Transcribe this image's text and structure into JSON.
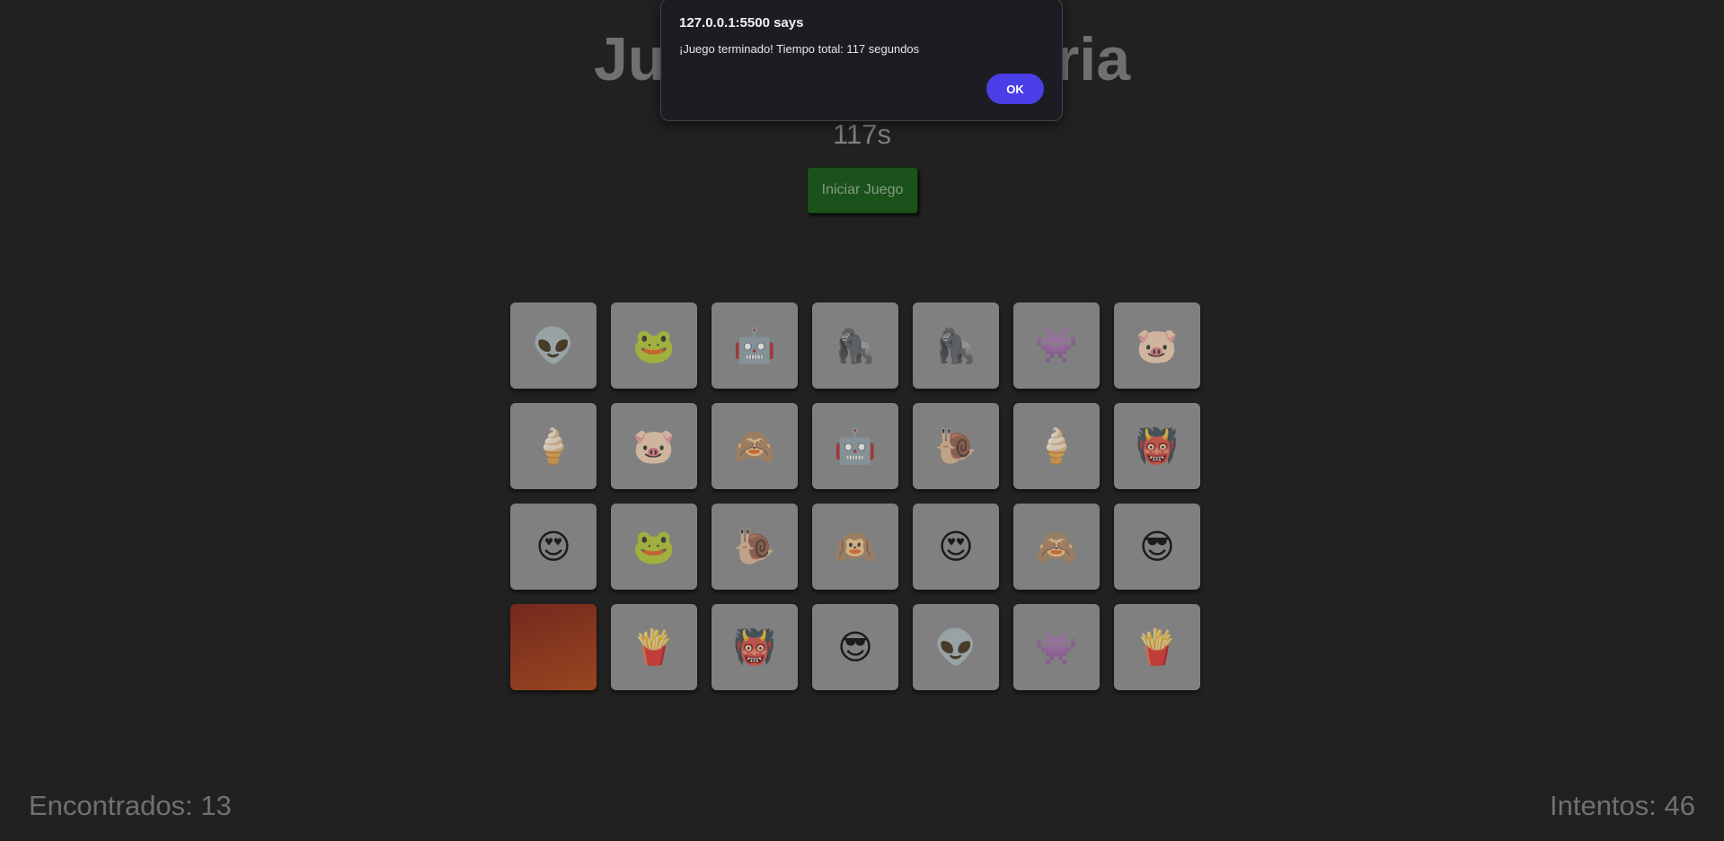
{
  "game": {
    "title": "Juego de Memoria",
    "timer": "117s",
    "start_button": "Iniciar Juego",
    "found_text": "Encontrados: 13",
    "attempts_text": "Intentos: 46",
    "card_back_color": "#b34a18",
    "cards": [
      {
        "icon": "alien-icon",
        "emoji": "👽",
        "face_up": true
      },
      {
        "icon": "frog-icon",
        "emoji": "🐸",
        "face_up": true
      },
      {
        "icon": "robot-icon",
        "emoji": "🤖",
        "face_up": true
      },
      {
        "icon": "gorilla-icon",
        "emoji": "🦍",
        "face_up": true
      },
      {
        "icon": "gorilla-icon",
        "emoji": "🦍",
        "face_up": true
      },
      {
        "icon": "space-invader-icon",
        "emoji": "👾",
        "face_up": true
      },
      {
        "icon": "pig-icon",
        "emoji": "🐷",
        "face_up": true
      },
      {
        "icon": "ice-cream-icon",
        "emoji": "🍦",
        "face_up": true
      },
      {
        "icon": "pig-icon",
        "emoji": "🐷",
        "face_up": true
      },
      {
        "icon": "see-no-evil-monkey-icon",
        "emoji": "🙈",
        "face_up": true
      },
      {
        "icon": "robot-icon",
        "emoji": "🤖",
        "face_up": true
      },
      {
        "icon": "snail-icon",
        "emoji": "🐌",
        "face_up": true
      },
      {
        "icon": "ice-cream-icon",
        "emoji": "🍦",
        "face_up": true
      },
      {
        "icon": "devil-icon",
        "emoji": "👹",
        "face_up": true
      },
      {
        "icon": "heart-eyes-icon",
        "emoji": "😍",
        "face_up": true
      },
      {
        "icon": "frog-icon",
        "emoji": "🐸",
        "face_up": true
      },
      {
        "icon": "snail-icon",
        "emoji": "🐌",
        "face_up": true
      },
      {
        "icon": "hear-no-evil-monkey-icon",
        "emoji": "🙉",
        "face_up": true
      },
      {
        "icon": "heart-eyes-icon",
        "emoji": "😍",
        "face_up": true
      },
      {
        "icon": "see-no-evil-monkey-icon",
        "emoji": "🙈",
        "face_up": true
      },
      {
        "icon": "sunglasses-face-icon",
        "emoji": "😎",
        "face_up": true
      },
      {
        "icon": "card-back-icon",
        "emoji": "",
        "face_up": false
      },
      {
        "icon": "fries-icon",
        "emoji": "🍟",
        "face_up": true
      },
      {
        "icon": "devil-icon",
        "emoji": "👹",
        "face_up": true
      },
      {
        "icon": "sunglasses-face-icon",
        "emoji": "😎",
        "face_up": true
      },
      {
        "icon": "alien-icon",
        "emoji": "👽",
        "face_up": true
      },
      {
        "icon": "space-invader-icon",
        "emoji": "👾",
        "face_up": true
      },
      {
        "icon": "fries-icon",
        "emoji": "🍟",
        "face_up": true
      }
    ]
  },
  "dialog": {
    "title": "127.0.0.1:5500 says",
    "message": "¡Juego terminado! Tiempo total: 117 segundos",
    "ok_label": "OK",
    "ok_color": "#4a3ee6"
  }
}
